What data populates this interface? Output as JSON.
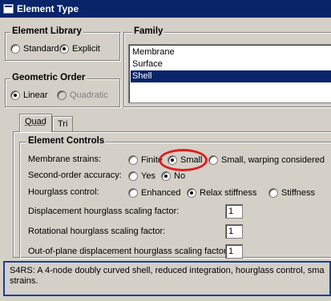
{
  "window": {
    "title": "Element Type"
  },
  "element_library": {
    "legend": "Element Library",
    "options": [
      {
        "label": "Standard",
        "selected": false
      },
      {
        "label": "Explicit",
        "selected": true
      }
    ]
  },
  "family": {
    "legend": "Family",
    "items": [
      "Membrane",
      "Surface",
      "Shell"
    ],
    "selected": "Shell"
  },
  "geometric_order": {
    "legend": "Geometric Order",
    "options": [
      {
        "label": "Linear",
        "selected": true,
        "enabled": true
      },
      {
        "label": "Quadratic",
        "selected": false,
        "enabled": false
      }
    ]
  },
  "tabs": [
    "Quad",
    "Tri"
  ],
  "element_controls": {
    "legend": "Element Controls",
    "membrane_strains": {
      "label": "Membrane strains:",
      "options": [
        "Finite",
        "Small",
        "Small, warping considered"
      ],
      "selected": "Small"
    },
    "second_order": {
      "label": "Second-order accuracy:",
      "options": [
        "Yes",
        "No"
      ],
      "selected": "No"
    },
    "hourglass": {
      "label": "Hourglass control:",
      "options": [
        "Enhanced",
        "Relax stiffness",
        "Stiffness"
      ],
      "selected": "Relax stiffness"
    },
    "displacement_factor": {
      "label": "Displacement hourglass scaling factor:",
      "value": "1"
    },
    "rotational_factor": {
      "label": "Rotational hourglass scaling factor:",
      "value": "1"
    },
    "out_of_plane_factor": {
      "label": "Out-of-plane displacement hourglass scaling factor:",
      "value": "1"
    }
  },
  "description": {
    "line1": "S4RS:  A 4-node doubly curved shell, reduced integration, hourglass control, sma",
    "line2": "strains."
  },
  "annotation_color": "#e01e1e"
}
